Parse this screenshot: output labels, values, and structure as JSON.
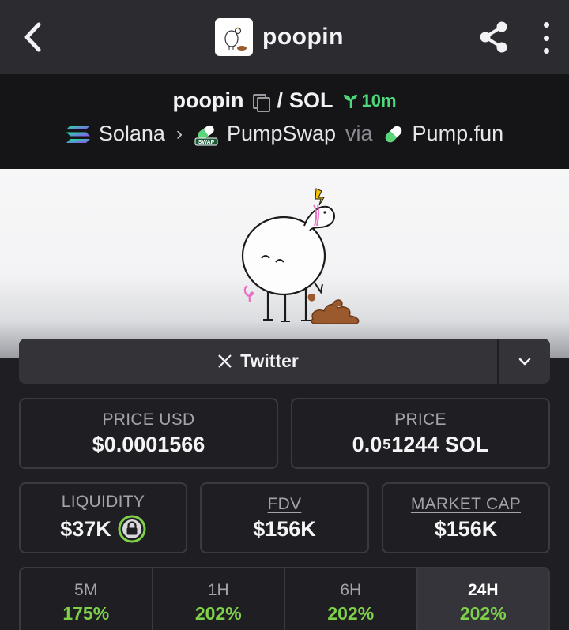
{
  "header": {
    "title": "poopin",
    "back_icon": "chevron-left-icon",
    "share_icon": "share-icon",
    "more_icon": "more-vertical-icon"
  },
  "pair": {
    "base": "poopin",
    "separator": "/",
    "quote": "SOL",
    "age": "10m",
    "age_color": "#4cd97b"
  },
  "chain": {
    "network": "Solana",
    "dex": "PumpSwap",
    "dex_badge": "SWAP",
    "via": "via",
    "launchpad": "Pump.fun"
  },
  "social": {
    "twitter_label": "Twitter",
    "twitter_icon": "x-logo-icon"
  },
  "stats": {
    "price_usd": {
      "label": "PRICE USD",
      "value": "$0.0001566"
    },
    "price": {
      "label": "PRICE",
      "prefix": "0.0",
      "zeros": "5",
      "suffix": "1244 SOL"
    },
    "liquidity": {
      "label": "LIQUIDITY",
      "value": "$37K"
    },
    "fdv": {
      "label": "FDV",
      "value": "$156K"
    },
    "market_cap": {
      "label": "MARKET CAP",
      "value": "$156K"
    }
  },
  "timeframes": [
    {
      "label": "5M",
      "change": "175%"
    },
    {
      "label": "1H",
      "change": "202%"
    },
    {
      "label": "6H",
      "change": "202%"
    },
    {
      "label": "24H",
      "change": "202%",
      "active": true
    }
  ],
  "colors": {
    "positive": "#7fd14a",
    "background": "#1f1f23"
  }
}
